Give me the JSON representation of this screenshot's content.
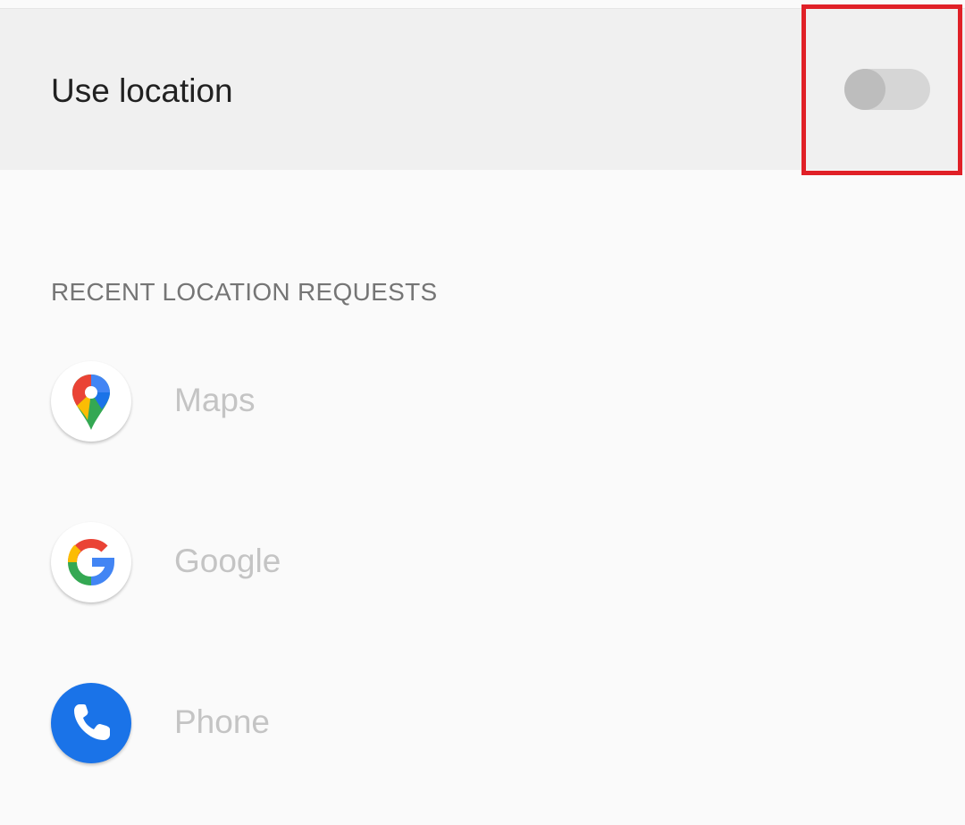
{
  "location_toggle": {
    "label": "Use location",
    "enabled": false
  },
  "recent_requests": {
    "header": "RECENT LOCATION REQUESTS",
    "apps": [
      {
        "name": "Maps",
        "icon": "google-maps-icon"
      },
      {
        "name": "Google",
        "icon": "google-icon"
      },
      {
        "name": "Phone",
        "icon": "phone-icon"
      }
    ]
  },
  "colors": {
    "highlight": "#e02027",
    "phone_blue": "#1a73e8"
  }
}
